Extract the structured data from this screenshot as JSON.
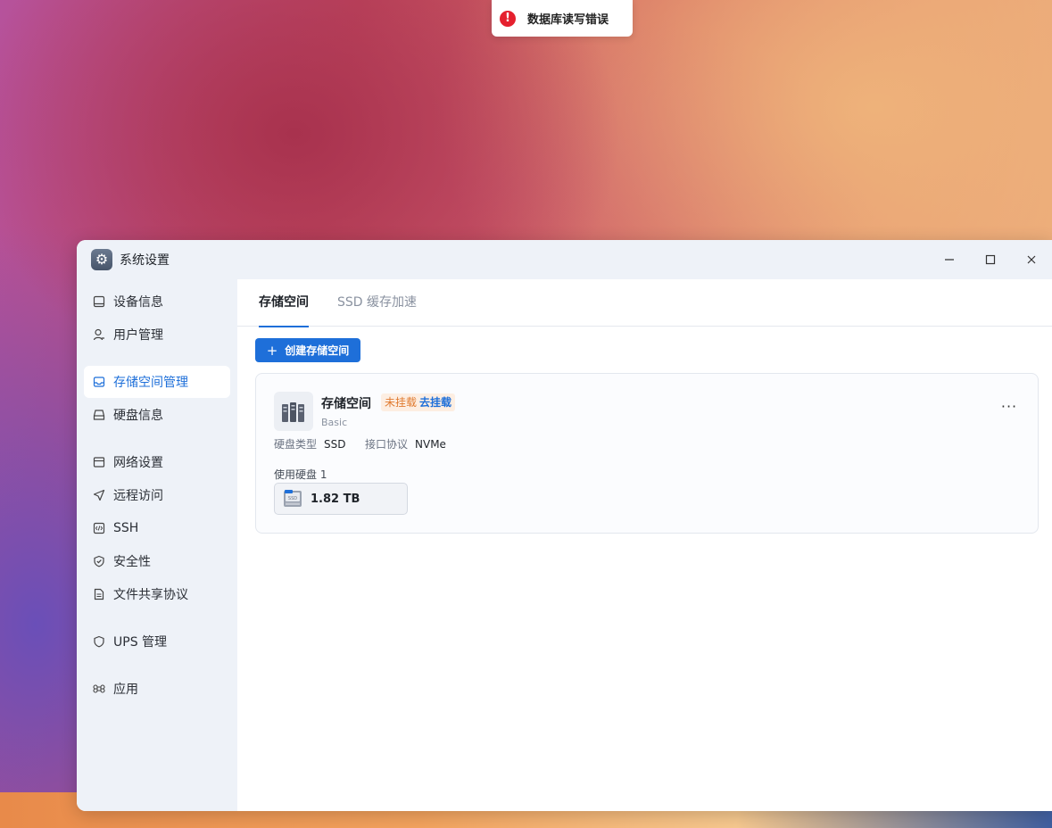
{
  "toast": {
    "message": "数据库读写错误",
    "icon": "error-icon",
    "color": "#e5202e"
  },
  "window": {
    "title": "系统设置",
    "controls": {
      "minimize": "minimize-icon",
      "maximize": "maximize-icon",
      "close": "close-icon"
    }
  },
  "sidebar": {
    "items": [
      {
        "label": "设备信息",
        "icon": "device-icon"
      },
      {
        "label": "用户管理",
        "icon": "user-icon"
      },
      {
        "label": "存储空间管理",
        "icon": "storage-icon",
        "active": true
      },
      {
        "label": "硬盘信息",
        "icon": "disk-icon"
      },
      {
        "label": "网络设置",
        "icon": "network-icon"
      },
      {
        "label": "远程访问",
        "icon": "send-icon"
      },
      {
        "label": "SSH",
        "icon": "code-icon"
      },
      {
        "label": "安全性",
        "icon": "shield-check-icon"
      },
      {
        "label": "文件共享协议",
        "icon": "document-icon"
      },
      {
        "label": "UPS 管理",
        "icon": "shield-icon"
      },
      {
        "label": "应用",
        "icon": "command-icon"
      }
    ]
  },
  "tabs": [
    {
      "label": "存储空间",
      "active": true
    },
    {
      "label": "SSD 缓存加速",
      "active": false
    }
  ],
  "toolbar": {
    "create_label": "创建存储空间"
  },
  "pool": {
    "name": "存储空间",
    "status": "未挂载",
    "mount_action": "去挂载",
    "type": "Basic",
    "disk_type_label": "硬盘类型",
    "disk_type_value": "SSD",
    "protocol_label": "接口协议",
    "protocol_value": "NVMe",
    "used_disks_label": "使用硬盘 1",
    "disk_size": "1.82 TB",
    "disk_badge": "SSD",
    "more": "···"
  },
  "colors": {
    "accent": "#1e6fd9",
    "warning": "#e07a2f",
    "error": "#e5202e"
  }
}
